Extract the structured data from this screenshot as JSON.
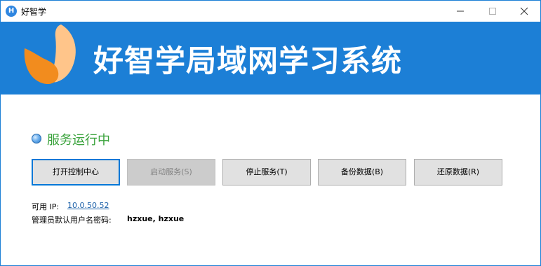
{
  "window": {
    "title": "好智学",
    "icon_letter": "H",
    "controls": [
      "minimize-icon",
      "maximize-icon",
      "close-icon"
    ]
  },
  "banner": {
    "title": "好智学局域网学习系统",
    "background": "#1c7fd6"
  },
  "status": {
    "text": "服务运行中",
    "color": "#38a23a"
  },
  "buttons": {
    "open_console": "打开控制中心",
    "start_service": "启动服务(S)",
    "stop_service": "停止服务(T)",
    "backup_data": "备份数据(B)",
    "restore_data": "还原数据(R)"
  },
  "info": {
    "ip_label": "可用 IP:",
    "ip_value": "10.0.50.52",
    "cred_label": "管理员默认用户名密码:",
    "cred_value": "hzxue, hzxue"
  }
}
